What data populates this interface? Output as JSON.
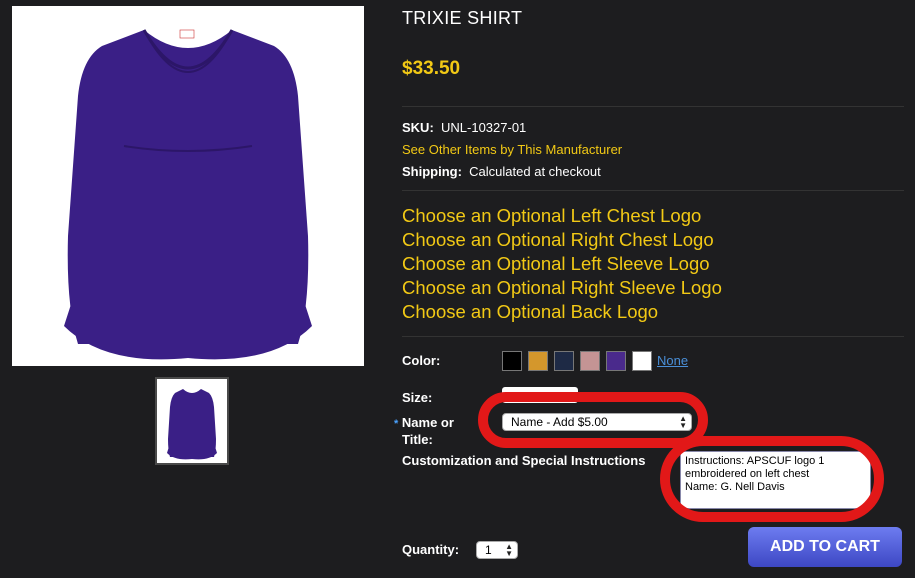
{
  "product": {
    "title": "TRIXIE SHIRT",
    "price": "$33.50",
    "sku_label": "SKU:",
    "sku_value": "UNL-10327-01",
    "manufacturer_link": "See Other Items by This Manufacturer",
    "shipping_label": "Shipping:",
    "shipping_value": "Calculated at checkout"
  },
  "logo_options": [
    "Choose an Optional Left Chest Logo",
    "Choose an Optional Right Chest Logo",
    "Choose an Optional Left Sleeve Logo",
    "Choose an Optional Right Sleeve Logo",
    "Choose an Optional Back Logo"
  ],
  "options": {
    "color_label": "Color:",
    "colors": [
      "#000000",
      "#d4972c",
      "#1e2a45",
      "#c49494",
      "#4a2a8c",
      "#ffffff"
    ],
    "color_none": "None",
    "size_label": "Size:",
    "name_required_marker": "*",
    "name_label_line1": "Name or",
    "name_label_line2": "Title:",
    "name_select_value": "Name - Add $5.00",
    "custom_label": "Customization and Special Instructions",
    "custom_value": "Instructions: APSCUF logo 1\nembroidered on left chest\nName: G. Nell Davis",
    "quantity_label": "Quantity:",
    "quantity_value": "1"
  },
  "cart_button": "ADD TO CART",
  "colors": {
    "accent": "#f2c915",
    "background": "#1d1d1f",
    "annotation": "#e21818",
    "button": "#4a55d8"
  }
}
